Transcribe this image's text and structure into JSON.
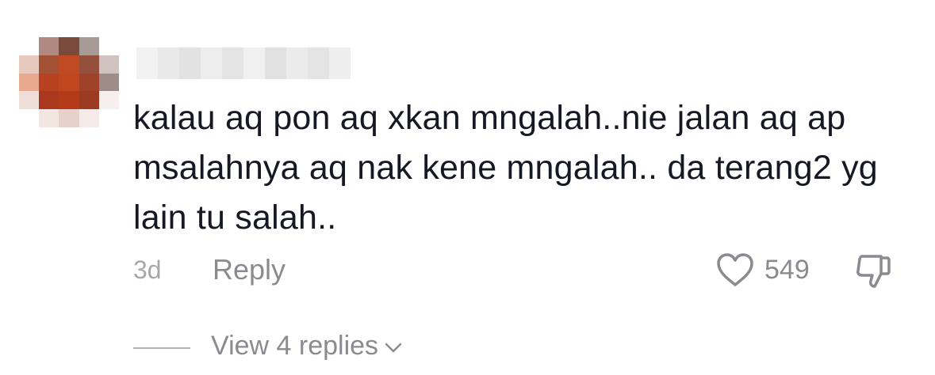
{
  "comment": {
    "text": "kalau aq pon aq xkan mngalah..nie jalan aq ap msalahnya aq nak kene mngalah.. da terang2 yg lain tu salah..",
    "timestamp": "3d",
    "reply_label": "Reply",
    "like_count": "549",
    "view_replies_label": "View 4 replies"
  },
  "icons": {
    "like": "heart-icon",
    "dislike": "thumbs-down-icon",
    "expand": "chevron-down-icon"
  },
  "colors": {
    "text": "#161823",
    "secondary": "#8a8b91",
    "timestamp": "#a8a8ab"
  }
}
